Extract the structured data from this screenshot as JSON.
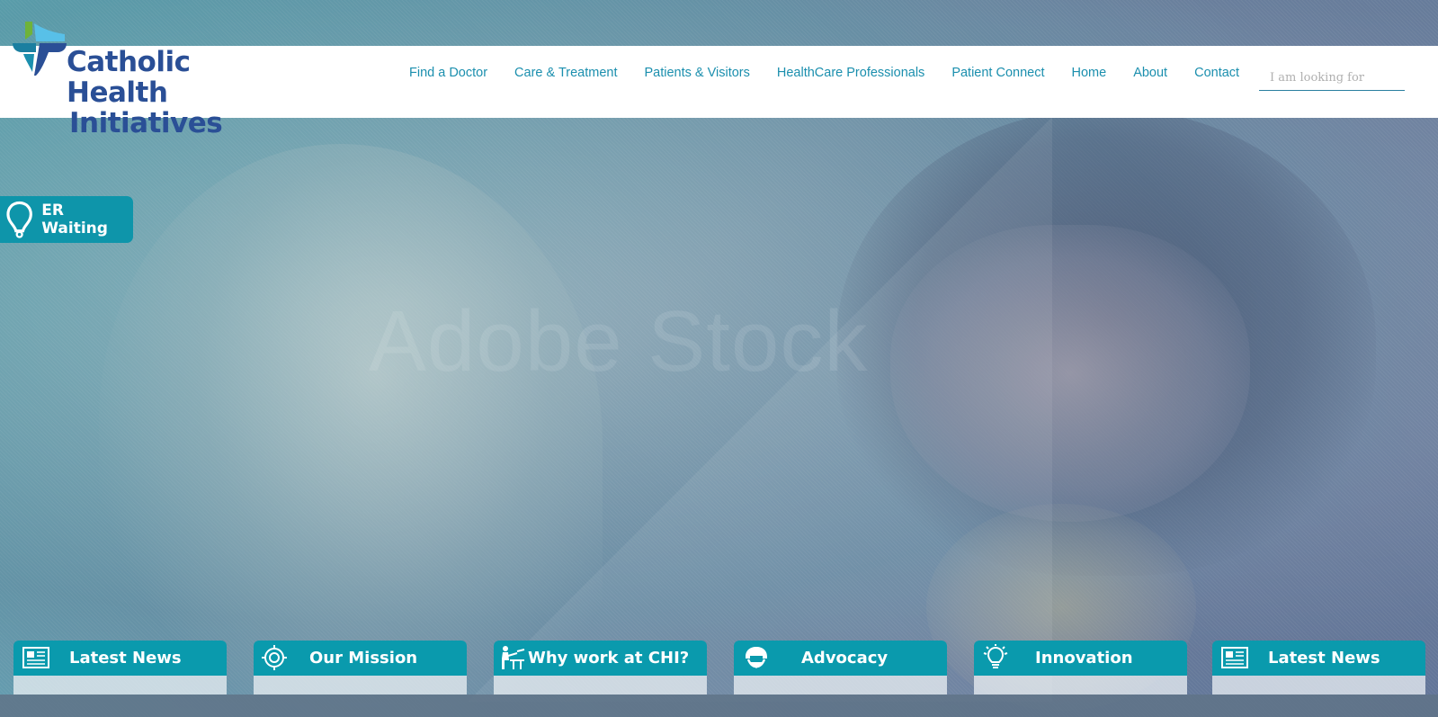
{
  "brand": {
    "name_line1": "Catholic Health",
    "name_line2": "Initiatives",
    "colors": {
      "primary": "#2a4f96",
      "accent": "#0a9aad",
      "nav": "#1b8fae",
      "leaf_green": "#6fb33a",
      "leaf_blue": "#58c0e8"
    }
  },
  "nav": {
    "items": [
      {
        "label": "Find a Doctor"
      },
      {
        "label": "Care & Treatment"
      },
      {
        "label": "Patients & Visitors"
      },
      {
        "label": "HealthCare Professionals"
      },
      {
        "label": "Patient Connect"
      },
      {
        "label": "Home"
      },
      {
        "label": "About"
      },
      {
        "label": "Contact"
      }
    ]
  },
  "search": {
    "placeholder": "I am looking for",
    "value": ""
  },
  "hero": {
    "watermark": "Adobe Stock"
  },
  "er_widget": {
    "label": "ER Waiting",
    "icon": "location-pin-icon"
  },
  "tiles": [
    {
      "label": "Latest News",
      "icon": "newspaper-icon"
    },
    {
      "label": "Our Mission",
      "icon": "target-icon"
    },
    {
      "label": "Why work at CHI?",
      "icon": "worker-desk-icon"
    },
    {
      "label": "Advocacy",
      "icon": "megaphone-icon"
    },
    {
      "label": "Innovation",
      "icon": "lightbulb-icon"
    },
    {
      "label": "Latest News",
      "icon": "newspaper-icon"
    }
  ]
}
